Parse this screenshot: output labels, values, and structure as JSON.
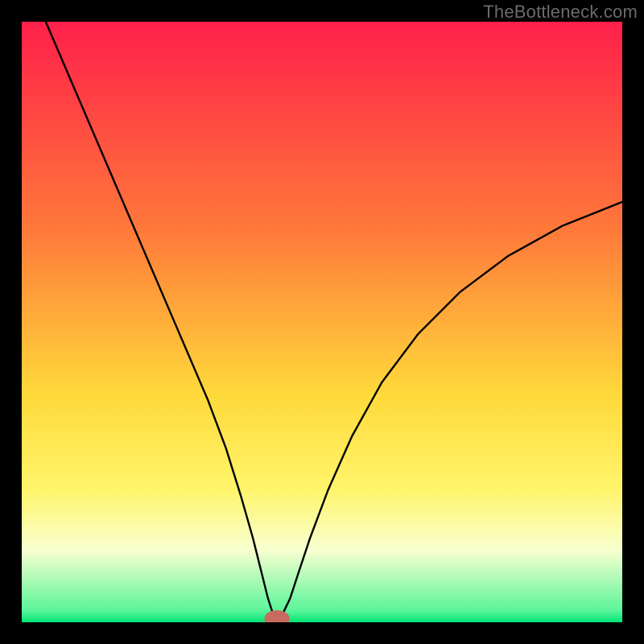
{
  "watermark": "TheBottleneck.com",
  "chart_data": {
    "type": "line",
    "title": "",
    "xlabel": "",
    "ylabel": "",
    "xlim": [
      0,
      100
    ],
    "ylim": [
      0,
      100
    ],
    "gradient_stops": [
      {
        "offset": 0,
        "color": "#ff1f4a"
      },
      {
        "offset": 35,
        "color": "#ff7a3a"
      },
      {
        "offset": 62,
        "color": "#ffd93a"
      },
      {
        "offset": 78,
        "color": "#fff56b"
      },
      {
        "offset": 88,
        "color": "#f8ffd0"
      },
      {
        "offset": 98,
        "color": "#5cf59a"
      },
      {
        "offset": 100,
        "color": "#00e676"
      }
    ],
    "series": [
      {
        "name": "bottleneck-curve",
        "x": [
          4,
          7,
          10,
          13,
          16,
          19,
          22,
          25,
          28,
          31,
          34,
          36.5,
          38.5,
          40,
          41,
          41.8,
          42.5,
          43.5,
          44.7,
          46,
          48,
          51,
          55,
          60,
          66,
          73,
          81,
          90,
          100
        ],
        "y": [
          100,
          93,
          86,
          79,
          72,
          65,
          58,
          51,
          44,
          37,
          29,
          21,
          14,
          8,
          4,
          1.5,
          0.6,
          1.5,
          4,
          8,
          14,
          22,
          31,
          40,
          48,
          55,
          61,
          66,
          70
        ]
      }
    ],
    "marker": {
      "x": 42.5,
      "y": 0.6,
      "rx": 1.6,
      "ry": 0.9,
      "color": "#c96a5e"
    }
  }
}
